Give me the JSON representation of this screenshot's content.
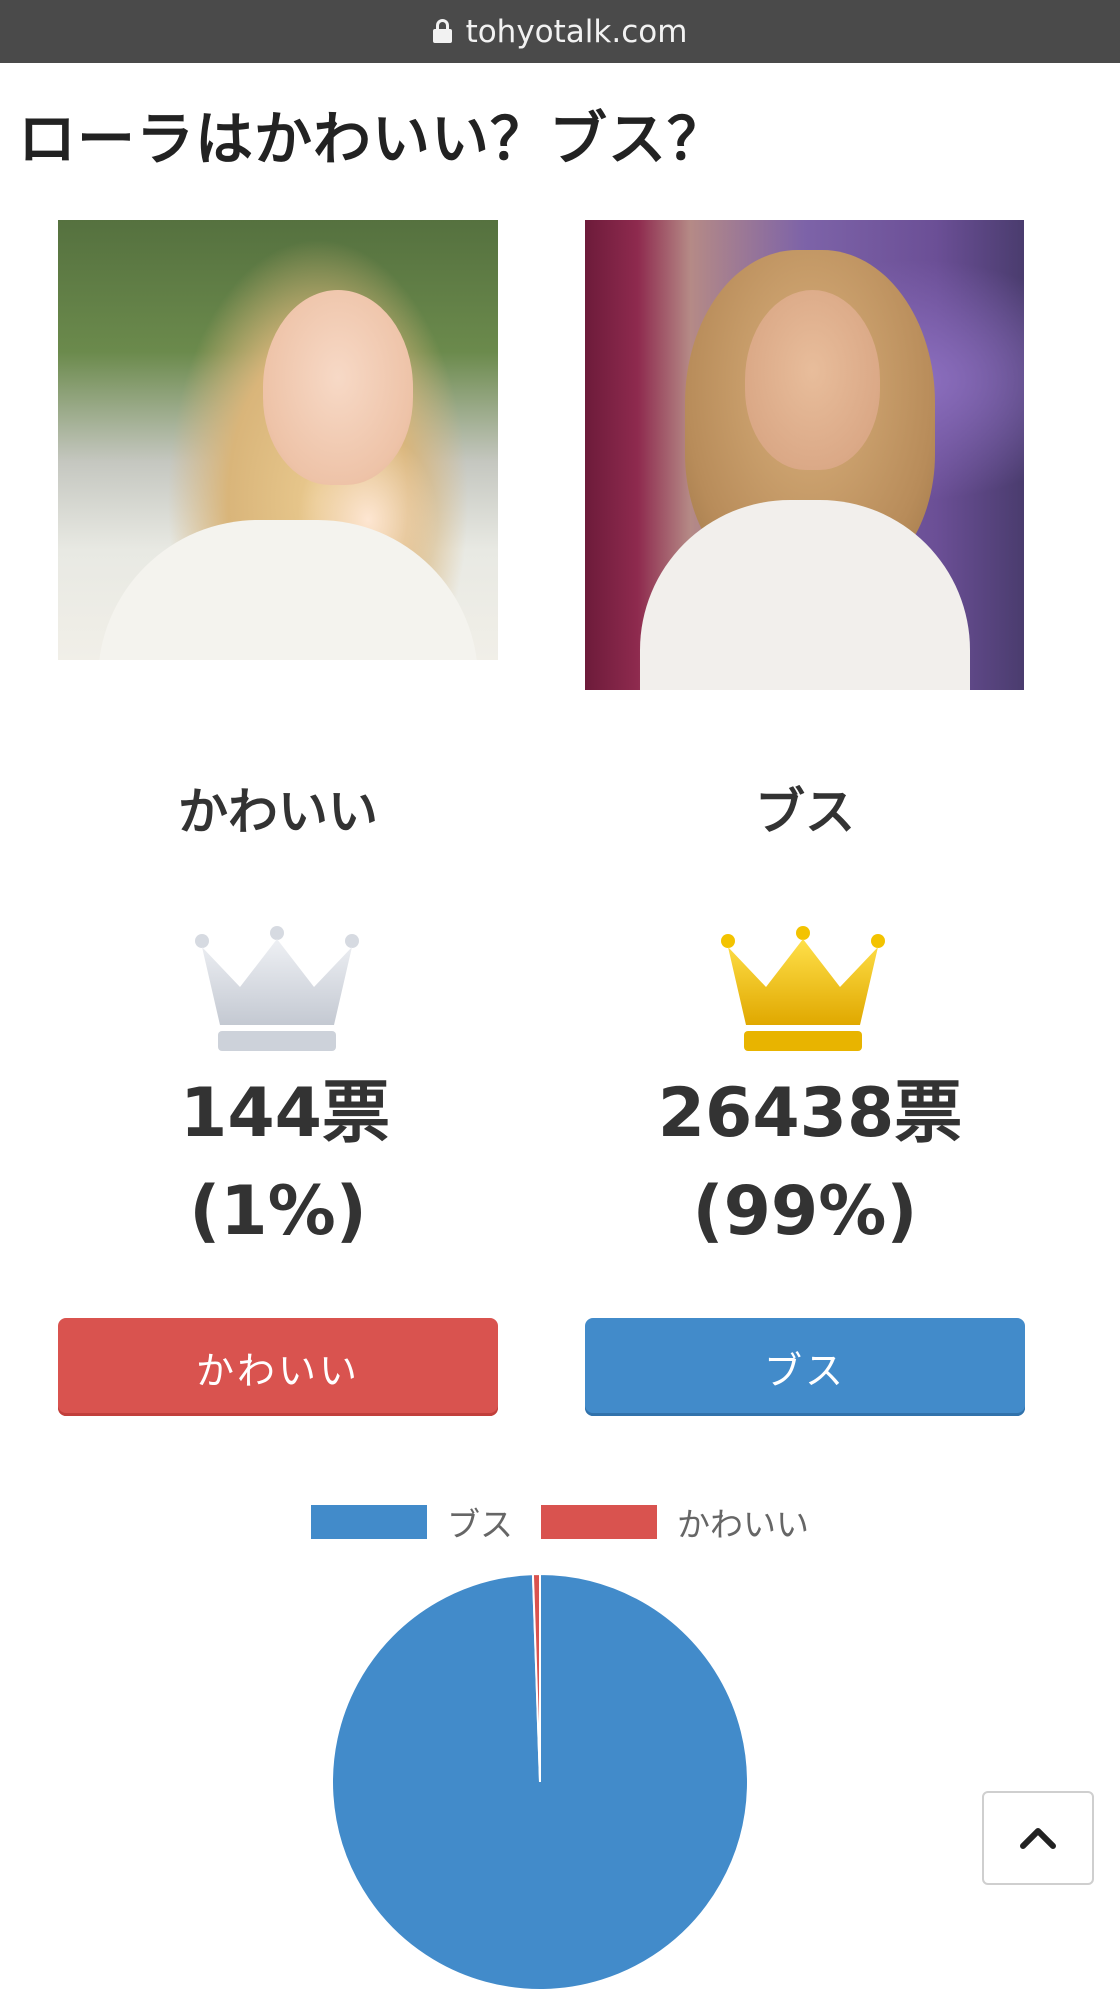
{
  "browser": {
    "url": "tohyotalk.com",
    "lock_icon": "lock-icon"
  },
  "page": {
    "title": "ローラはかわいい？ブス？"
  },
  "options": [
    {
      "label": "かわいい",
      "votes_text": "144票",
      "percent_text": "(1%)",
      "votes": 144,
      "percent": 1,
      "button_label": "かわいい",
      "color": "#d9534f",
      "crown": "silver-crown-icon"
    },
    {
      "label": "ブス",
      "votes_text": "26438票",
      "percent_text": "(99%)",
      "votes": 26438,
      "percent": 99,
      "button_label": "ブス",
      "color": "#428bca",
      "crown": "gold-crown-icon"
    }
  ],
  "scroll_top_icon": "chevron-up-icon",
  "chart_data": {
    "type": "pie",
    "labels": [
      "ブス",
      "かわいい"
    ],
    "values": [
      26438,
      144
    ],
    "colors": [
      "#428bca",
      "#d9534f"
    ],
    "legend": [
      "ブス",
      "かわいい"
    ],
    "legend_position": "top"
  }
}
